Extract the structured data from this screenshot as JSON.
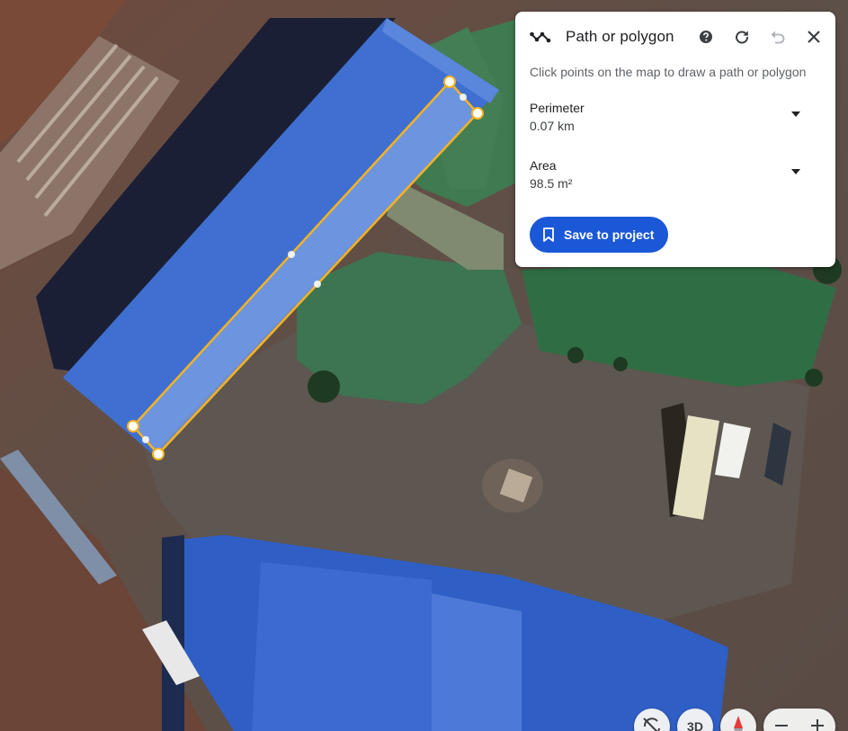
{
  "panel": {
    "title": "Path or polygon",
    "tool_icon": "path-polygon-icon",
    "help_icon": "help-icon",
    "redo_icon": "redo-icon",
    "undo_icon": "undo-icon",
    "close_icon": "close-icon",
    "instructions": "Click points on the map to draw a path or polygon",
    "perimeter_label": "Perimeter",
    "perimeter_value": "0.07 km",
    "area_label": "Area",
    "area_value": "98.5 m²",
    "save_label": "Save to project",
    "save_icon": "bookmark-icon",
    "dropdown_icon": "arrow-drop-down-icon"
  },
  "map_controls": {
    "rotate_icon": "rotate-map-icon",
    "three_d_label": "3D",
    "compass_icon": "compass-icon",
    "zoom_out_icon": "minus-icon",
    "zoom_in_icon": "plus-icon"
  },
  "colors": {
    "accent": "#1b58d8",
    "polygon_stroke": "#f5b323",
    "roof_blue": "#3f6fd0"
  }
}
